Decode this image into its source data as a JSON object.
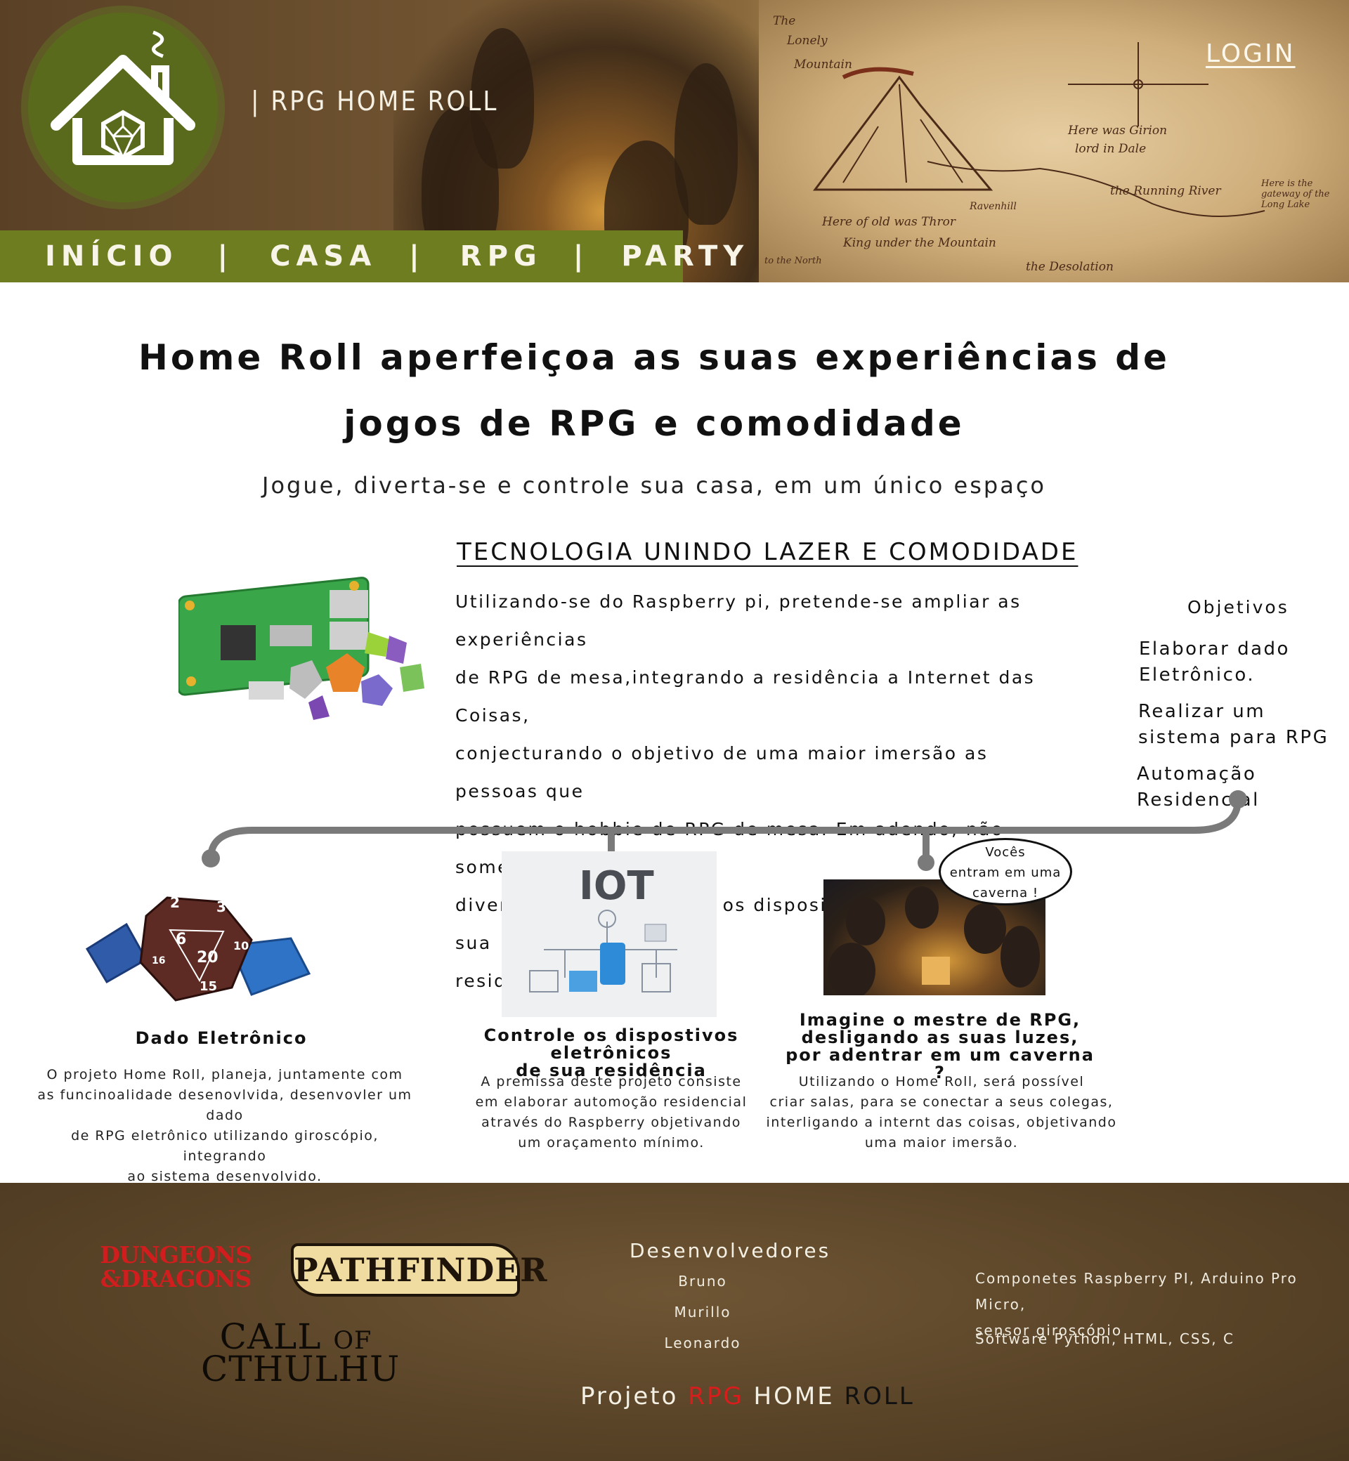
{
  "header": {
    "brand": "| RPG HOME ROLL",
    "login": "LOGIN",
    "map_labels": [
      "The",
      "Lonely",
      "Mountain",
      "Here was Girion",
      "lord in Dale",
      "the Running River",
      "Here of old was Thror",
      "King under the Mountain",
      "Here is the gateway of the Long Lake",
      "Ravenhill",
      "the Desolation",
      "to the North"
    ]
  },
  "nav": {
    "items": [
      "INÍCIO",
      "CASA",
      "RPG",
      "PARTY"
    ],
    "separator": "|"
  },
  "hero": {
    "title_line1": "Home Roll aperfeiçoa as suas experiências de",
    "title_line2": "jogos de RPG e comodidade",
    "subtitle": "Jogue, diverta-se e controle sua casa, em um único espaço"
  },
  "tech": {
    "title": "TECNOLOGIA UNINDO LAZER E COMODIDADE",
    "lines": [
      "Utilizando-se do Raspberry pi, pretende-se ampliar as experiências",
      "de RPG de mesa,integrando a residência a Internet das Coisas,",
      "conjecturando o objetivo de uma maior imersão as pessoas que",
      "possuem o hobbie de RPG de mesa. Em adendo, não somente",
      "divertir-se, mas verificar os dispositivos eletrônicos de sua",
      "residência."
    ]
  },
  "objectives": {
    "title": "Objetivos",
    "items": [
      [
        "Elaborar dado",
        "Eletrônico."
      ],
      [
        "Realizar um",
        "sistema para RPG"
      ],
      [
        "Automação Residencial"
      ]
    ]
  },
  "cards": [
    {
      "title": [
        "Dado Eletrônico"
      ],
      "body": [
        "O projeto Home Roll, planeja, juntamente com",
        "as funcinoalidade desenovlvida, desenvovler um dado",
        "de RPG eletrônico utilizando giroscópio, integrando",
        "ao sistema desenvolvido."
      ],
      "dice_numbers": [
        "2",
        "3",
        "6",
        "20",
        "15",
        "16",
        "10"
      ]
    },
    {
      "title": [
        "Controle os dispostivos eletrônicos",
        "de sua residência"
      ],
      "body": [
        "A premissa deste projeto consiste",
        "em elaborar automoção residencial",
        "através do Raspberry objetivando",
        "um oraçamento mínimo."
      ],
      "image_label": "IOT"
    },
    {
      "title": [
        "Imagine o mestre de RPG,",
        "desligando as suas luzes,",
        "por adentrar em um caverna ?"
      ],
      "body": [
        "Utilizando o Home Roll, será possível",
        "criar salas, para se conectar a seus colegas,",
        "interligando a internt das coisas, objetivando",
        "uma maior imersão."
      ],
      "bubble": [
        "Vocês",
        "entram em uma",
        "caverna !"
      ]
    }
  ],
  "footer": {
    "logos": {
      "dnd": [
        "DUNGEONS",
        "&DRAGONS"
      ],
      "pathfinder": "PATHFINDER",
      "cthulhu": [
        "CALL of",
        "CTHULHU"
      ]
    },
    "dev_title": "Desenvolvedores",
    "devs": [
      "Bruno",
      "Murillo",
      "Leonardo"
    ],
    "project": {
      "prefix": "Projeto ",
      "rpg": "RPG",
      "home": " HOME ",
      "roll": "ROLL"
    },
    "components": [
      "Componetes Raspberry PI, Arduino Pro Micro,",
      "sensor giroscópio"
    ],
    "software": "Software Python, HTML, CSS, C"
  },
  "colors": {
    "nav_green": "#6e7d1f",
    "logo_green": "#5a6a1c",
    "footer_brown": "#5a4428",
    "accent_red": "#d91c1c",
    "timeline_gray": "#7a7a7a"
  }
}
